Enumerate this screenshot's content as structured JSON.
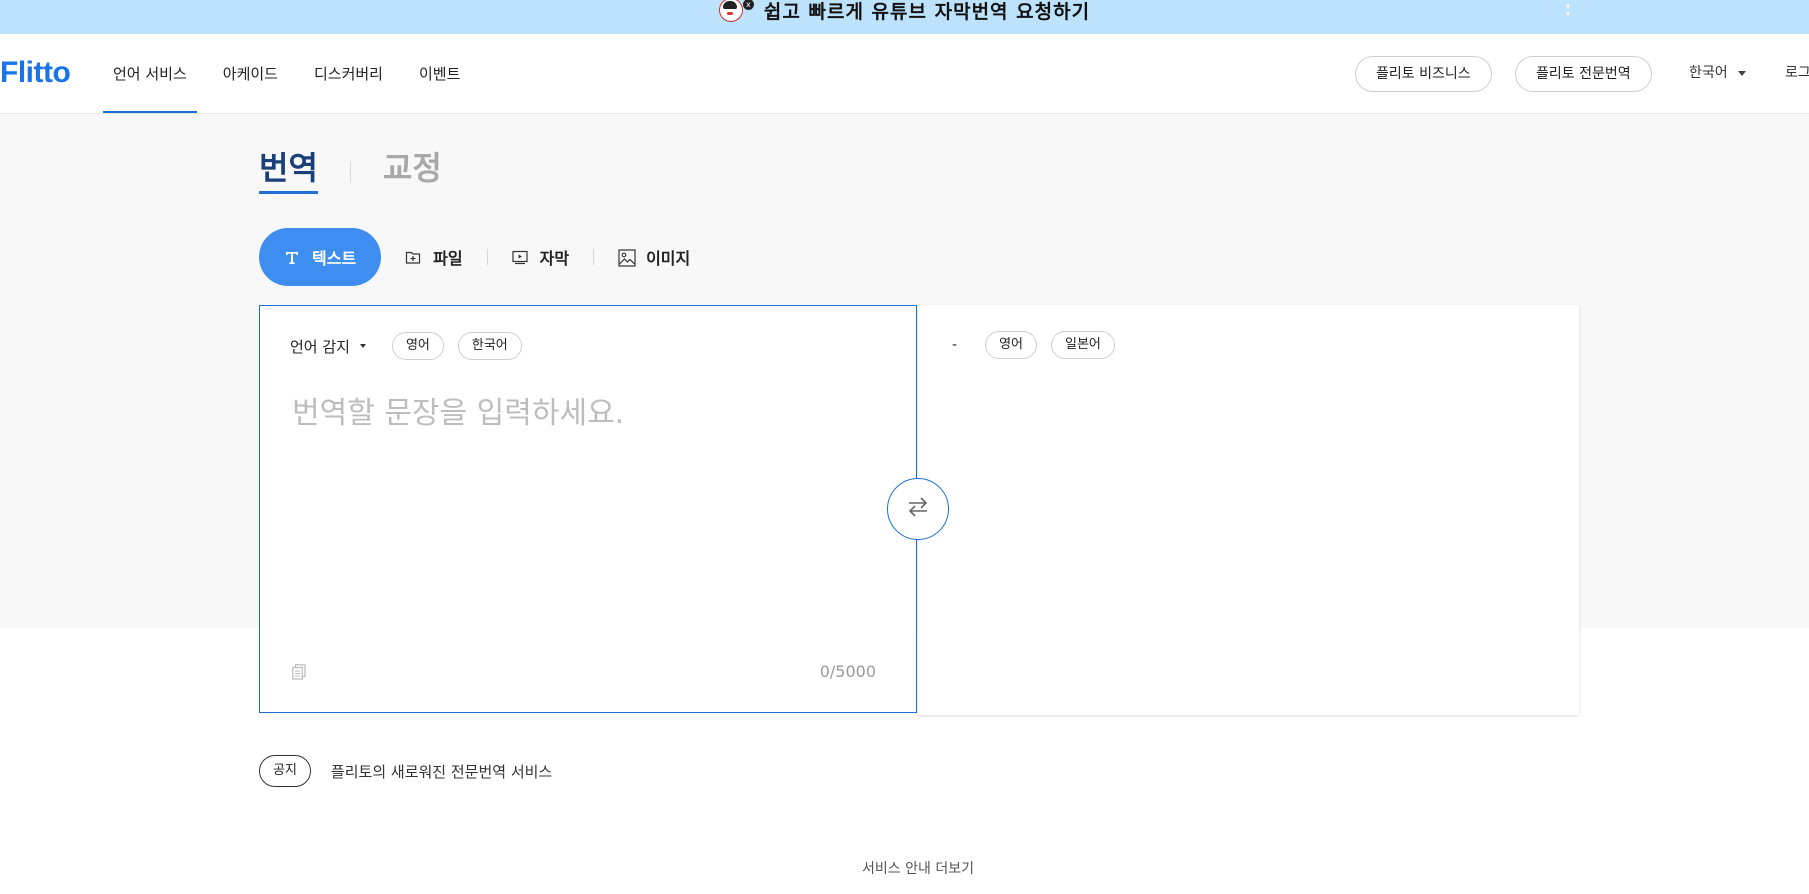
{
  "banner": {
    "text": "쉽고 빠르게 유튜브 자막번역 요청하기",
    "close_glyph": "x",
    "kebab_glyph": "⋮"
  },
  "header": {
    "logo": "Flitto",
    "nav": [
      {
        "label": "언어 서비스",
        "active": true
      },
      {
        "label": "아케이드"
      },
      {
        "label": "디스커버리"
      },
      {
        "label": "이벤트"
      }
    ],
    "business_button": "플리토 비즈니스",
    "pro_button": "플리토 전문번역",
    "language": "한국어",
    "login": "로그인"
  },
  "mode_tabs": {
    "translate": "번역",
    "proofread": "교정"
  },
  "type_tabs": {
    "text": "텍스트",
    "file": "파일",
    "subtitle": "자막",
    "image": "이미지"
  },
  "source": {
    "detect_label": "언어 감지",
    "chips": [
      "영어",
      "한국어"
    ],
    "placeholder": "번역할 문장을 입력하세요.",
    "char_count": "0/5000"
  },
  "target": {
    "dash": "-",
    "chips": [
      "영어",
      "일본어"
    ]
  },
  "notice": {
    "badge": "공지",
    "text": "플리토의 새로워진 전문번역 서비스"
  },
  "more_link": "서비스 안내 더보기",
  "colors": {
    "accent": "#1f6fd6",
    "tab_active_bg": "#3d8ef0",
    "banner_bg": "#bde2fb"
  }
}
